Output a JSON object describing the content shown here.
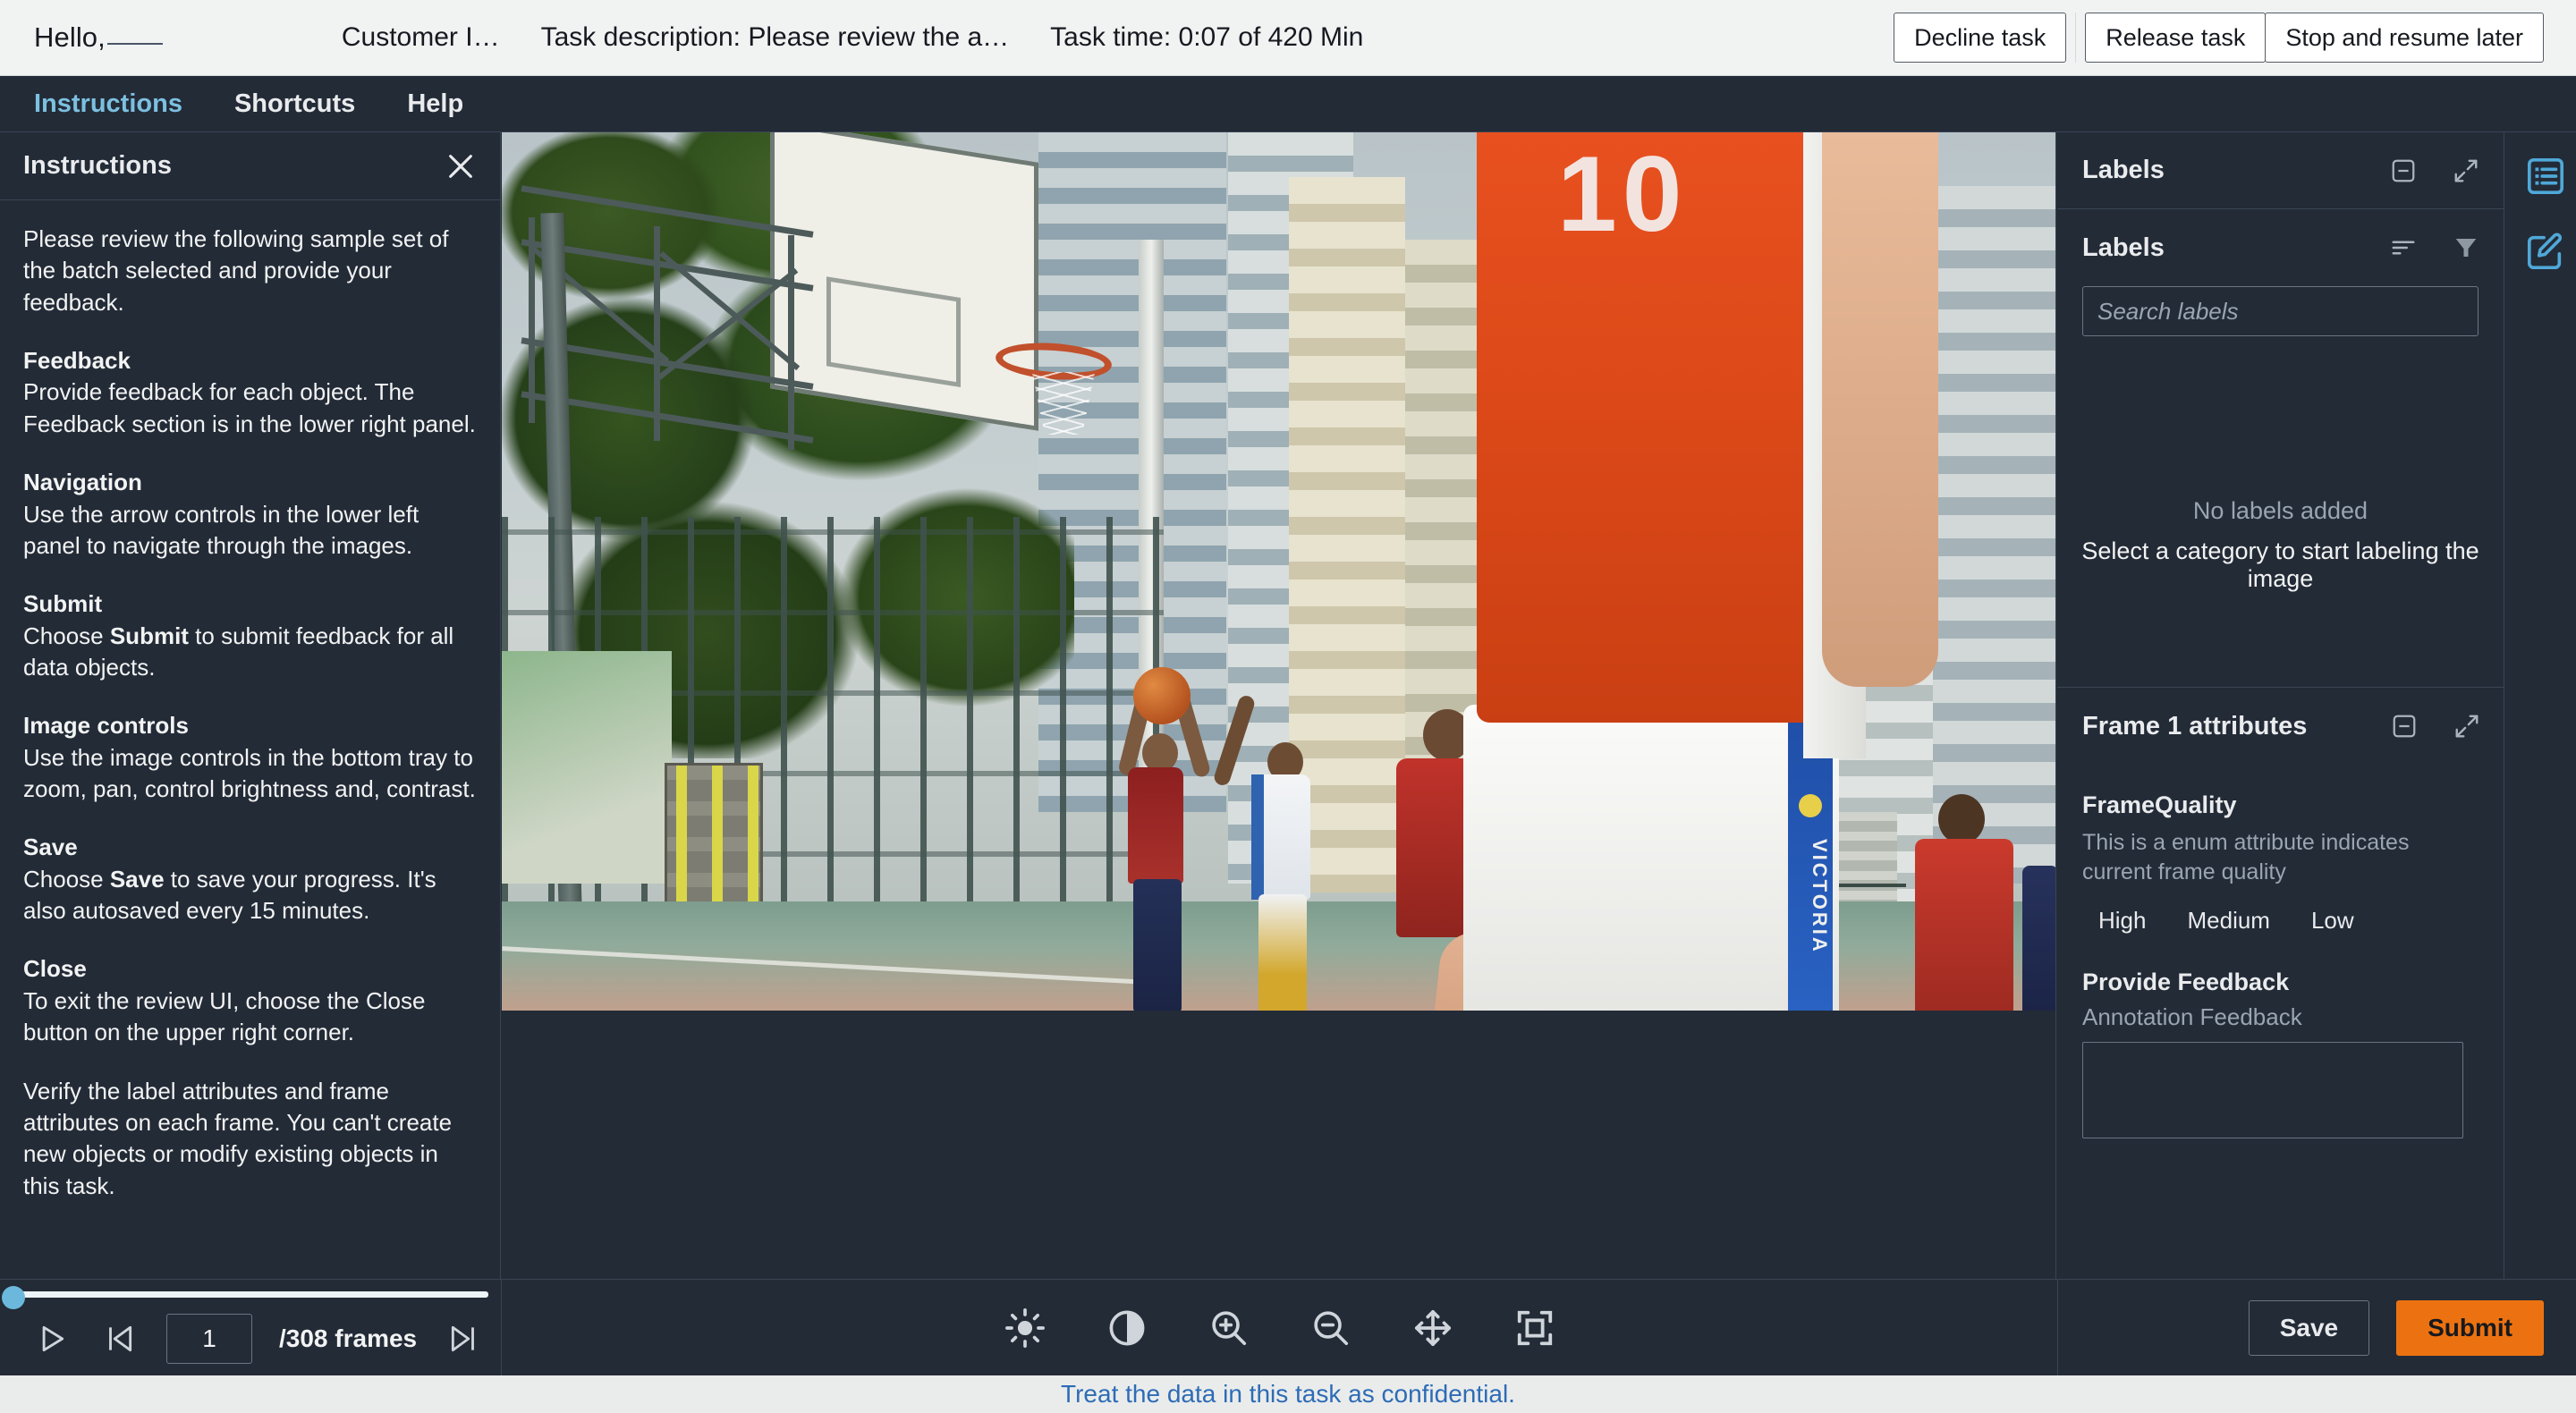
{
  "header": {
    "greeting": "Hello,",
    "customer_id": "Customer I…",
    "task_description": "Task description: Please review the a…",
    "task_time": "Task time: 0:07 of 420 Min",
    "buttons": {
      "decline": "Decline task",
      "release": "Release task",
      "stop": "Stop and resume later"
    }
  },
  "tabs": [
    {
      "label": "Instructions",
      "active": true
    },
    {
      "label": "Shortcuts",
      "active": false
    },
    {
      "label": "Help",
      "active": false
    }
  ],
  "instructions_panel": {
    "title": "Instructions",
    "close_icon": "close-icon",
    "intro": "Please review the following sample set of the batch selected and provide your feedback.",
    "sections": [
      {
        "heading": "Feedback",
        "body": "Provide feedback for each object. The Feedback section is in the lower right panel."
      },
      {
        "heading": "Navigation",
        "body": "Use the arrow controls in the lower left panel to navigate through the images."
      },
      {
        "heading": "Submit",
        "body_pre": "Choose ",
        "body_bold": "Submit",
        "body_post": " to submit feedback for all data objects."
      },
      {
        "heading": "Image controls",
        "body": "Use the image controls in the bottom tray to zoom, pan, control brightness and, contrast."
      },
      {
        "heading": "Save",
        "body_pre": "Choose ",
        "body_bold": "Save",
        "body_post": " to save your progress. It's also autosaved every 15 minutes."
      },
      {
        "heading": "Close",
        "body": "To exit the review UI, choose the Close button on the upper right corner."
      }
    ],
    "footer_note": "Verify the label attributes and frame attributes on each frame. You can't create new objects or modify existing objects in this task."
  },
  "labels_panel": {
    "section_title": "Labels",
    "collapse_icon": "minus-box-icon",
    "expand_icon": "expand-arrows-icon",
    "sub_title": "Labels",
    "sort_icon": "sort-icon",
    "filter_icon": "filter-icon",
    "search_placeholder": "Search labels",
    "search_value": "",
    "empty_title": "No labels added",
    "empty_subtitle": "Select a category to start labeling the image"
  },
  "frame_attributes": {
    "section_title": "Frame 1 attributes",
    "collapse_icon": "minus-box-icon",
    "expand_icon": "expand-arrows-icon",
    "attribute_name": "FrameQuality",
    "attribute_description": "This is a enum attribute indicates current frame quality",
    "options": [
      "High",
      "Medium",
      "Low"
    ],
    "provide_feedback_label": "Provide Feedback",
    "annotation_feedback_label": "Annotation Feedback",
    "feedback_value": ""
  },
  "right_rail": {
    "list_icon": "list-panel-icon",
    "edit_icon": "edit-pencil-icon"
  },
  "bottom_bar": {
    "play_icon": "play-icon",
    "first_frame_icon": "skip-to-first-icon",
    "frame_number": "1",
    "frames_total": "/308 frames",
    "last_frame_icon": "skip-to-last-icon",
    "timeline_position_percent": 0,
    "tools": [
      {
        "name": "brightness-icon",
        "label": "Brightness"
      },
      {
        "name": "contrast-icon",
        "label": "Contrast"
      },
      {
        "name": "zoom-in-icon",
        "label": "Zoom in"
      },
      {
        "name": "zoom-out-icon",
        "label": "Zoom out"
      },
      {
        "name": "pan-move-icon",
        "label": "Pan"
      },
      {
        "name": "fit-to-screen-icon",
        "label": "Fit to screen"
      }
    ],
    "save_label": "Save",
    "submit_label": "Submit"
  },
  "footer": {
    "confidential_notice": "Treat the data in this task as confidential."
  },
  "colors": {
    "panel_bg": "#232b37",
    "header_bg": "#f1f3f3",
    "accent_blue": "#7cc0e0",
    "submit_orange": "#ec7211",
    "footer_link": "#2e6cb5",
    "border": "#3a4453"
  },
  "canvas": {
    "image_alt": "outdoor-basketball-game-photo",
    "player_number": "10",
    "shorts_text": "VICTORIA"
  }
}
